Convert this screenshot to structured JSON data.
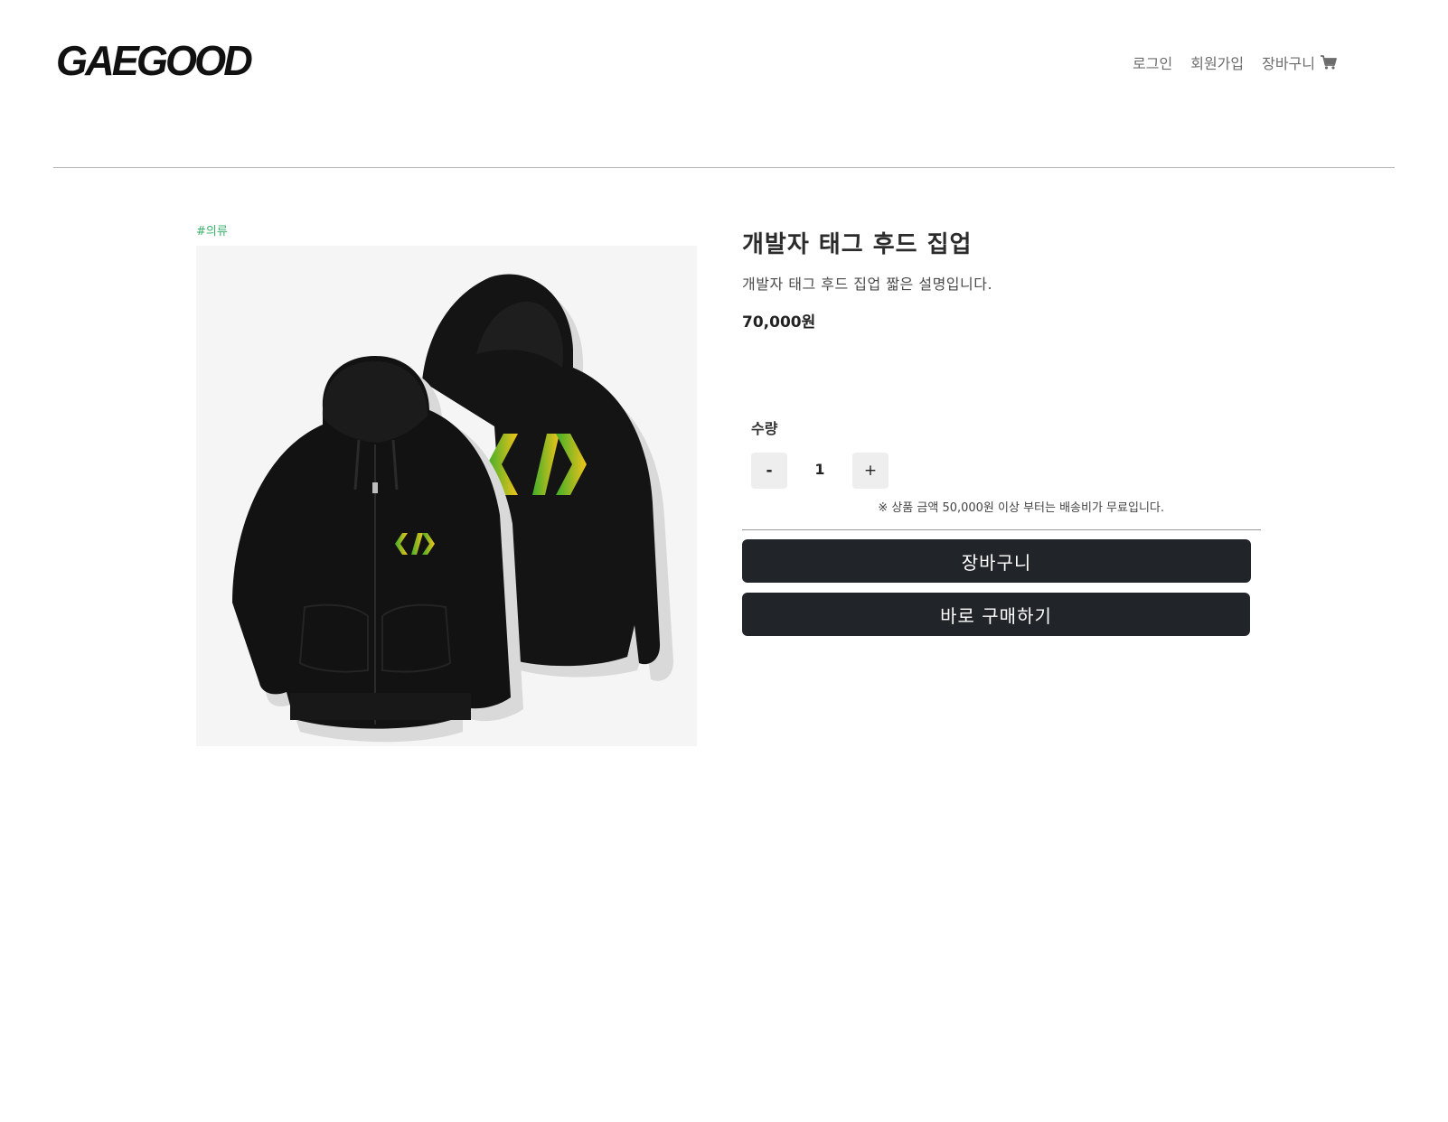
{
  "header": {
    "logo": "GAEGOOD",
    "nav": {
      "login": "로그인",
      "signup": "회원가입",
      "cart": "장바구니"
    }
  },
  "product": {
    "category": "#의류",
    "title": "개발자 태그 후드 집업",
    "description": "개발자 태그 후드 집업 짧은 설명입니다.",
    "price": "70,000원",
    "image_alt": "black zip-up hoodie with </> logo"
  },
  "quantity": {
    "label": "수량",
    "minus": "-",
    "value": "1",
    "plus": "+"
  },
  "shipping_note": "※ 상품 금액 50,000원 이상 부터는 배송비가 무료입니다.",
  "actions": {
    "add_to_cart": "장바구니",
    "buy_now": "바로 구매하기"
  },
  "colors": {
    "accent_tag": "#3db36b",
    "button_dark": "#212529",
    "logo_gradient_start": "#3fae2a",
    "logo_gradient_end": "#f2c319"
  },
  "icons": {
    "cart": "shopping-cart-icon"
  }
}
